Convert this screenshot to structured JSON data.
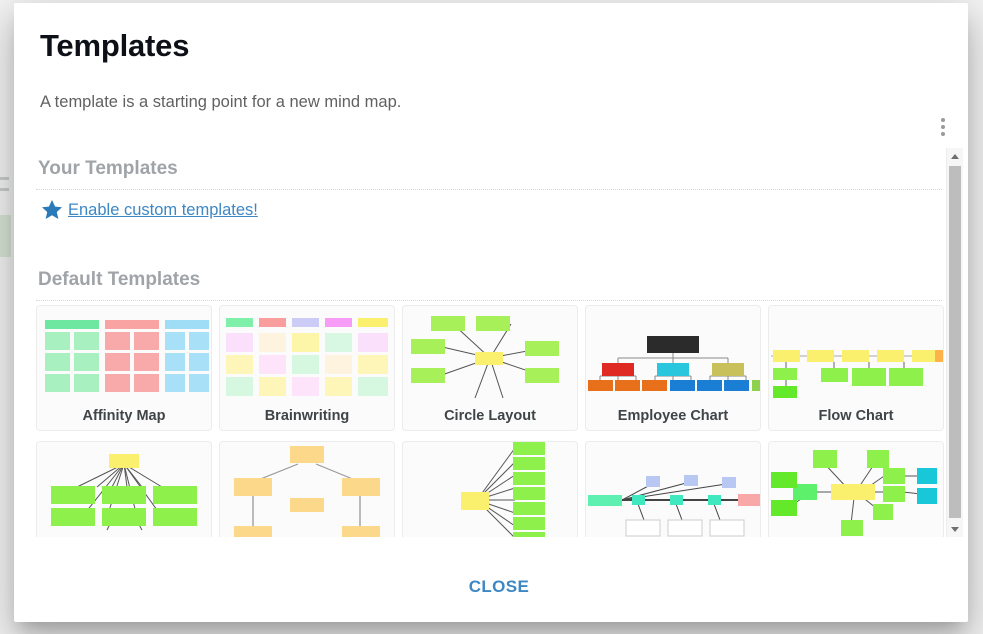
{
  "dialog": {
    "title": "Templates",
    "subtitle": "A template is a starting point for a new mind map.",
    "menu_icon": "kebab-menu-icon",
    "close_label": "CLOSE"
  },
  "sections": {
    "your_templates": {
      "heading": "Your Templates",
      "link_text": "Enable custom templates!",
      "link_icon": "star-icon",
      "link_color": "#3d87c4"
    },
    "default_templates": {
      "heading": "Default Templates"
    }
  },
  "templates": [
    {
      "label": "Affinity Map",
      "thumb": "affinity"
    },
    {
      "label": "Brainwriting",
      "thumb": "brainwriting"
    },
    {
      "label": "Circle Layout",
      "thumb": "circle"
    },
    {
      "label": "Employee Chart",
      "thumb": "employee"
    },
    {
      "label": "Flow Chart",
      "thumb": "flow"
    },
    {
      "label": "",
      "thumb": "radial-green"
    },
    {
      "label": "",
      "thumb": "org-orange"
    },
    {
      "label": "",
      "thumb": "fan-right"
    },
    {
      "label": "",
      "thumb": "timeline-blue"
    },
    {
      "label": "",
      "thumb": "star-burst"
    }
  ],
  "scrollbar": {
    "up_icon": "chevron-up-icon",
    "down_icon": "chevron-down-icon"
  },
  "colors": {
    "accent": "#3d87c4",
    "title": "#0d1117",
    "section_heading": "#a0a4a8",
    "card_label": "#3f4447"
  }
}
